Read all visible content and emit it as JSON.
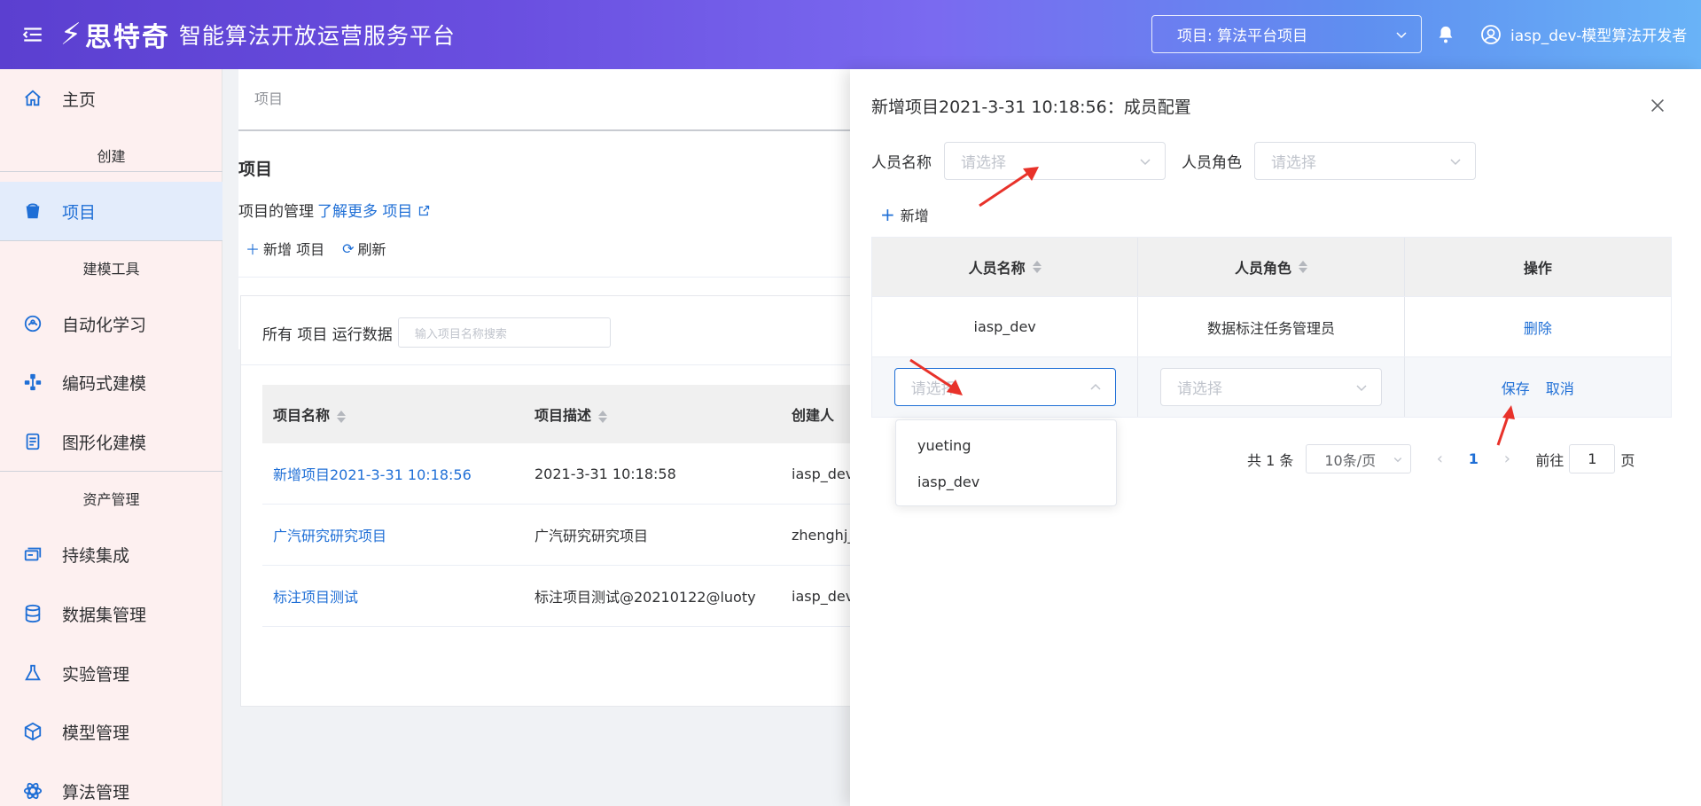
{
  "header": {
    "logo_mark": "⚡",
    "brand": "思特奇",
    "title": "智能算法开放运营服务平台",
    "project_select": "项目: 算法平台项目",
    "user": "iasp_dev-模型算法开发者"
  },
  "sidebar": {
    "home": "主页",
    "section_create": "创建",
    "project": "项目",
    "section_tools": "建模工具",
    "automl": "自动化学习",
    "code_modeling": "编码式建模",
    "graph_modeling": "图形化建模",
    "section_assets": "资产管理",
    "ci": "持续集成",
    "dataset": "数据集管理",
    "experiment": "实验管理",
    "model": "模型管理",
    "algorithm": "算法管理"
  },
  "main": {
    "breadcrumb": "项目",
    "title": "项目",
    "desc": "项目的管理",
    "learn_more": "了解更多 项目",
    "new_project": "新增 项目",
    "refresh": "刷新",
    "filter_label": "所有 项目 运行数据",
    "search_placeholder": "输入项目名称搜索",
    "columns": [
      "项目名称",
      "项目描述",
      "创建人"
    ],
    "rows": [
      {
        "name": "新增项目2021-3-31 10:18:56",
        "desc": "2021-3-31 10:18:58",
        "creator": "iasp_dev"
      },
      {
        "name": "广汽研究研究项目",
        "desc": "广汽研究研究项目",
        "creator": "zhenghj_"
      },
      {
        "name": "标注项目测试",
        "desc": "标注项目测试@20210122@luoty",
        "creator": "iasp_dev"
      }
    ]
  },
  "drawer": {
    "title": "新增项目2021-3-31 10:18:56：成员配置",
    "filter_name_label": "人员名称",
    "filter_role_label": "人员角色",
    "select_placeholder": "请选择",
    "add_label": "新增",
    "columns": [
      "人员名称",
      "人员角色",
      "操作"
    ],
    "member_row": {
      "name": "iasp_dev",
      "role": "数据标注任务管理员",
      "action": "删除"
    },
    "save": "保存",
    "cancel": "取消",
    "dropdown_options": [
      "yueting",
      "iasp_dev"
    ],
    "pager": {
      "total": "共 1 条",
      "page_size": "10条/页",
      "current": "1",
      "goto_label": "前往",
      "goto_value": "1",
      "page_unit": "页"
    }
  },
  "colors": {
    "accent": "#1f6fd6",
    "annotation_arrow": "#e8322a"
  }
}
